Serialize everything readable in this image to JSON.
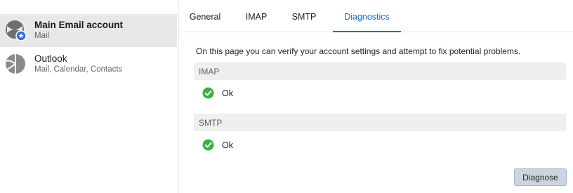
{
  "sidebar": {
    "accounts": [
      {
        "name": "Main Email account",
        "sub": "Mail",
        "selected": true,
        "icon": "email-account-icon"
      },
      {
        "name": "Outlook",
        "sub": "Mail, Calendar, Contacts",
        "selected": false,
        "icon": "outlook-icon"
      }
    ]
  },
  "tabs": [
    {
      "label": "General",
      "active": false
    },
    {
      "label": "IMAP",
      "active": false
    },
    {
      "label": "SMTP",
      "active": false
    },
    {
      "label": "Diagnostics",
      "active": true
    }
  ],
  "main": {
    "intro": "On this page you can verify your account settings and attempt to fix potential problems.",
    "sections": [
      {
        "title": "IMAP",
        "status": "Ok",
        "status_icon": "check-circle-icon"
      },
      {
        "title": "SMTP",
        "status": "Ok",
        "status_icon": "check-circle-icon"
      }
    ],
    "diagnose_label": "Diagnose"
  },
  "colors": {
    "accent": "#1a6fc1",
    "success": "#3cb043",
    "selected_bg": "#e8e8e8",
    "button_bg": "#ccd5df"
  }
}
